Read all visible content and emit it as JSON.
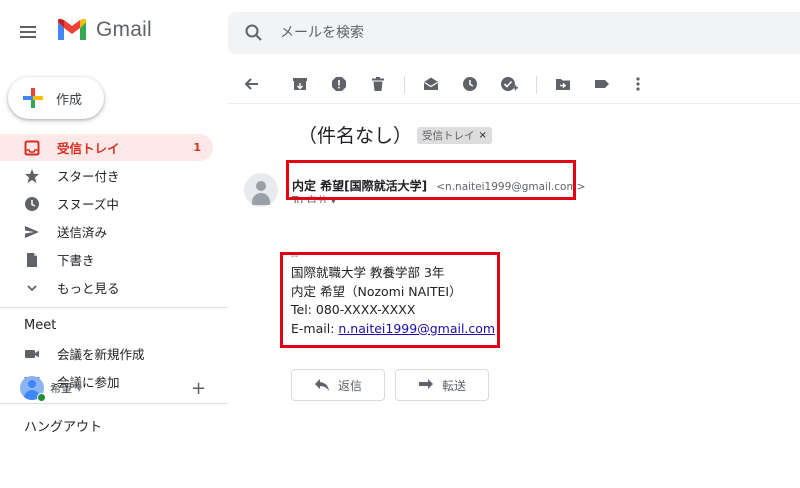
{
  "app": {
    "name": "Gmail"
  },
  "search": {
    "placeholder": "メールを検索"
  },
  "compose": {
    "label": "作成"
  },
  "sidebar": {
    "items": [
      {
        "label": "受信トレイ",
        "count": "1"
      },
      {
        "label": "スター付き"
      },
      {
        "label": "スヌーズ中"
      },
      {
        "label": "送信済み"
      },
      {
        "label": "下書き"
      },
      {
        "label": "もっと見る"
      }
    ],
    "meet": {
      "title": "Meet",
      "items": [
        {
          "label": "会議を新規作成"
        },
        {
          "label": "会議に参加"
        }
      ]
    },
    "hangouts": {
      "title": "ハングアウト",
      "user": "希望"
    }
  },
  "email": {
    "subject": "（件名なし）",
    "label_chip": "受信トレイ",
    "chip_close": "×",
    "sender_name": "内定 希望[国際就活大学]",
    "sender_email": "<n.naitei1999@gmail.com>",
    "to_line": "To 自分 ▾",
    "signature": {
      "dash": "--",
      "line1": "国際就職大学 教養学部 3年",
      "line2": "内定 希望（Nozomi NAITEI）",
      "line3": "Tel: 080-XXXX-XXXX",
      "email_prefix": "E-mail: ",
      "email_link": "n.naitei1999@gmail.com"
    },
    "reply_label": "返信",
    "forward_label": "転送"
  },
  "colors": {
    "accent_red": "#d93025",
    "highlight_red": "#e60012",
    "active_bg": "#fce8e6",
    "link_blue": "#1a0dab"
  },
  "icons": {
    "toolbar": [
      "back-icon",
      "archive-icon",
      "report-spam-icon",
      "delete-icon",
      "mark-unread-icon",
      "snooze-icon",
      "add-task-icon",
      "move-to-icon",
      "label-icon",
      "more-icon"
    ]
  }
}
